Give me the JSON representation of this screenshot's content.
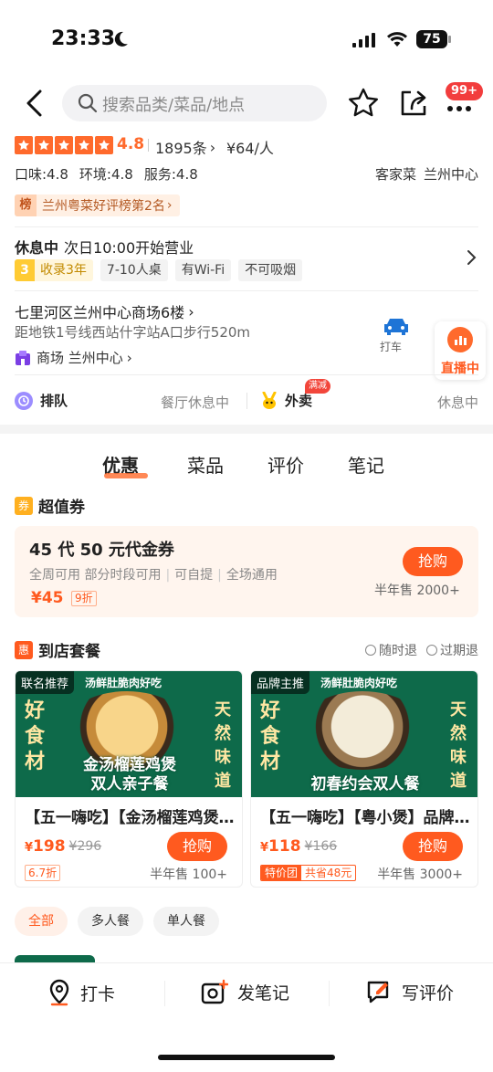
{
  "status_bar": {
    "time": "23:33",
    "battery": "75"
  },
  "nav": {
    "search_placeholder": "搜索品类/菜品/地点",
    "badge": "99+"
  },
  "shop": {
    "rating": "4.8",
    "review_count": "1895条",
    "avg_price": "¥64/人",
    "scores": [
      "口味:4.8",
      "环境:4.8",
      "服务:4.8"
    ],
    "cuisine": "客家菜",
    "area": "兰州中心",
    "rank_icon": "榜",
    "rank_text": "兰州粤菜好评榜第2名",
    "status": "休息中",
    "hours": "次日10:00开始营业",
    "tags": {
      "years_num": "3",
      "years_text": "收录3年",
      "items": [
        "7-10人桌",
        "有Wi-Fi",
        "不可吸烟"
      ]
    },
    "address": "七里河区兰州中心商场6楼",
    "distance": "距地铁1号线西站什字站A口步行520m",
    "mall": "商场 兰州中心",
    "taxi": "打车",
    "live": "直播中",
    "queue_label": "排队",
    "queue_status": "餐厅休息中",
    "delivery_label": "外卖",
    "delivery_badge": "满减",
    "delivery_status": "休息中"
  },
  "tabs": [
    "优惠",
    "菜品",
    "评价",
    "笔记"
  ],
  "coupon_section": {
    "icon": "券",
    "title": "超值券",
    "coupon": {
      "title": "45 代 50 元代金券",
      "rules": [
        "全周可用 部分时段可用",
        "可自提",
        "全场通用"
      ],
      "price": "¥45",
      "discount": "9折",
      "buy_label": "抢购",
      "sold": "半年售 2000+"
    }
  },
  "set_section": {
    "icon": "惠",
    "title": "到店套餐",
    "policies": [
      "随时退",
      "过期退"
    ],
    "deals": [
      {
        "label": "联名推荐",
        "slogan": "汤鲜肚脆肉好吃",
        "left_text": "好食材",
        "right_text": "天然味道",
        "caption1": "金汤榴莲鸡煲",
        "caption2": "双人亲子餐",
        "name": "【五一嗨吃】【金汤榴莲鸡煲】双人亲子餐",
        "price_symbol": "¥",
        "price": "198",
        "orig": "¥296",
        "buy_label": "抢购",
        "tag": "6.7折",
        "sold": "半年售 100+"
      },
      {
        "label": "品牌主推",
        "slogan": "汤鲜肚脆肉好吃",
        "left_text": "好食材",
        "right_text": "天然味道",
        "caption1": "初春约会双人餐",
        "caption2": "",
        "name": "【五一嗨吃】【粤小煲】品牌主推初春约会双人餐",
        "price_symbol": "¥",
        "price": "118",
        "orig": "¥166",
        "buy_label": "抢购",
        "tag_a": "特价团",
        "tag_b": "共省48元",
        "sold": "半年售 3000+"
      }
    ],
    "filters": [
      "全部",
      "多人餐",
      "单人餐"
    ]
  },
  "bottom_bar": {
    "checkin": "打卡",
    "note": "发笔记",
    "review": "写评价"
  },
  "colors": {
    "accent": "#ff5a1f",
    "deal_bg": "#0e6a4a"
  }
}
